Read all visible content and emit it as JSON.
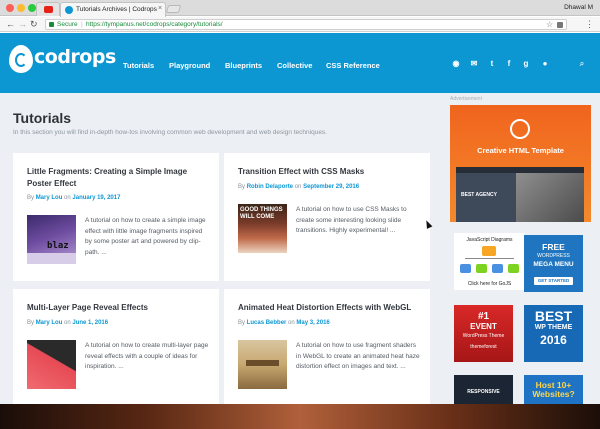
{
  "browser": {
    "tab_title": "Tutorials Archives | Codrops",
    "user": "Dhawal M",
    "url_secure": "Secure",
    "url": "https://tympanus.net/codrops/category/tutorials/"
  },
  "site": {
    "logo_text": "codrops",
    "nav": [
      "Tutorials",
      "Playground",
      "Blueprints",
      "Collective",
      "CSS Reference"
    ]
  },
  "page": {
    "title": "Tutorials",
    "description": "In this section you will find in-depth how-tos involving common web development and web design techniques."
  },
  "articles": [
    {
      "title": "Little Fragments: Creating a Simple Image Poster Effect",
      "by": "By",
      "author": "Mary Lou",
      "on": "on",
      "date": "January 19, 2017",
      "thumb_text": "blaz",
      "excerpt": "A tutorial on how to create a simple image effect with little image fragments inspired by some poster art and powered by clip-path. ..."
    },
    {
      "title": "Transition Effect with CSS Masks",
      "by": "By",
      "author": "Robin Delaporte",
      "on": "on",
      "date": "September 29, 2016",
      "thumb_text": "GOOD THINGS WILL COME",
      "excerpt": "A tutorial on how to use CSS Masks to create some interesting looking slide transitions. Highly experimental! ..."
    },
    {
      "title": "Multi-Layer Page Reveal Effects",
      "by": "By",
      "author": "Mary Lou",
      "on": "on",
      "date": "June 1, 2016",
      "thumb_text": "",
      "excerpt": "A tutorial on how to create multi-layer page reveal effects with a couple of ideas for inspiration. ..."
    },
    {
      "title": "Animated Heat Distortion Effects with WebGL",
      "by": "By",
      "author": "Lucas Bebber",
      "on": "on",
      "date": "May 3, 2016",
      "thumb_text": "",
      "excerpt": "A tutorial on how to use fragment shaders in WebGL to create an animated heat haze distortion effect on images and text. ..."
    }
  ],
  "ads": {
    "label": "Advertisement",
    "main": {
      "title": "Creative HTML Template",
      "shot_label": "BEST AGENCY"
    },
    "js": {
      "title": "JavaScript Diagrams",
      "footer": "Click here for GoJS"
    },
    "wp": {
      "line1": "FREE",
      "line2": "WORDPRESS",
      "line3": "MEGA MENU",
      "button": "GET STARTED"
    },
    "event": {
      "num": "#1",
      "title": "EVENT",
      "sub": "WordPress Theme",
      "foot": "themeforest"
    },
    "best": {
      "line1": "BEST",
      "line2": "WP THEME",
      "line3": "2016"
    },
    "responsive": {
      "text": "RESPONSIVE"
    },
    "host": {
      "text": "Host 10+ Websites?"
    }
  },
  "colors": {
    "header": "#0c97d3",
    "background": "#ecf0f4",
    "link": "#0c97d3"
  }
}
